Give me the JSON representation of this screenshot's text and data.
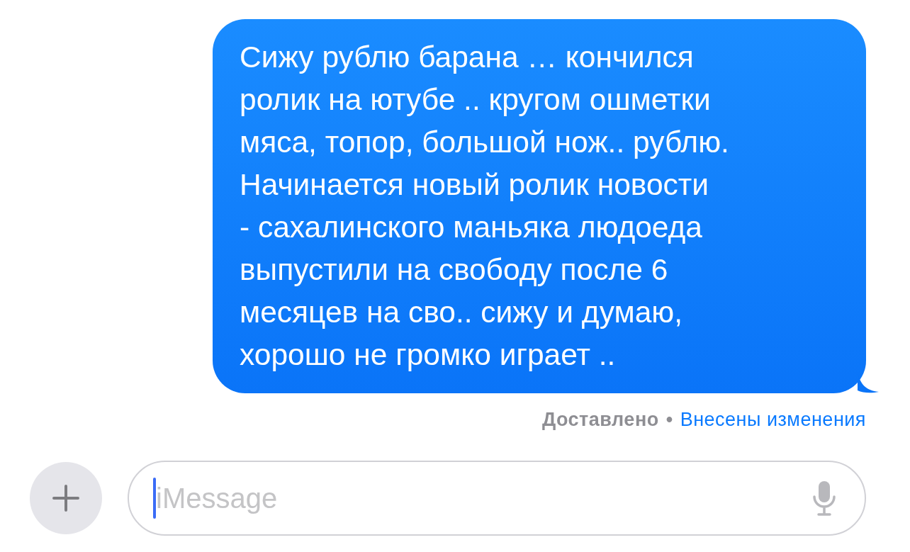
{
  "message": {
    "text": "Сижу рублю барана … кончился\nролик на ютубе .. кругом ошметки\nмяса, топор, большой нож.. рублю.\nНачинается новый ролик новости\n- сахалинского маньяка людоеда\nвыпустили на свободу после 6\nмесяцев на сво.. сижу и думаю,\nхорошо не громко играет .."
  },
  "status": {
    "delivered": "Доставлено",
    "separator": "•",
    "edited": "Внесены изменения"
  },
  "composer": {
    "placeholder": "iMessage",
    "focused": true
  }
}
